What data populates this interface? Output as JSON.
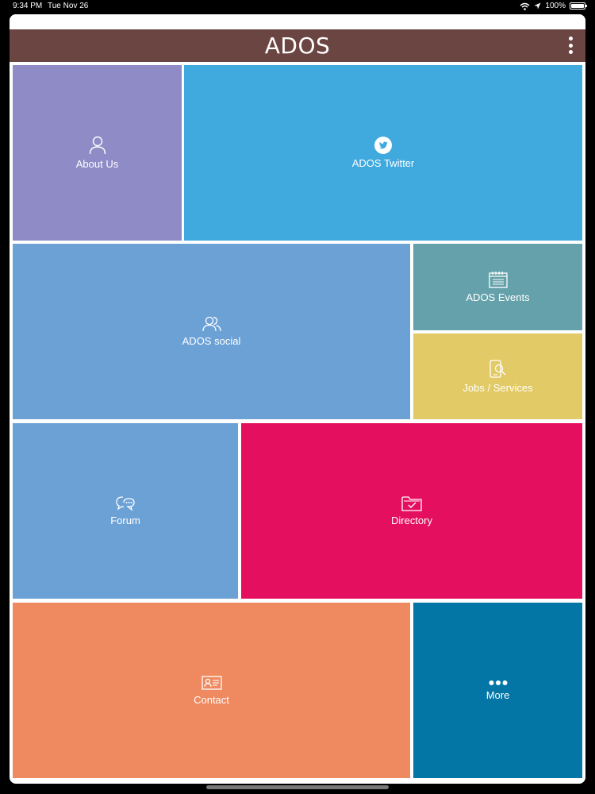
{
  "status_bar": {
    "time": "9:34 PM",
    "date": "Tue Nov 26",
    "battery": "100%"
  },
  "app": {
    "title": "ADOS"
  },
  "tiles": {
    "about": {
      "label": "About Us",
      "color": "#8f8bc6",
      "icon": "person-icon"
    },
    "twitter": {
      "label": "ADOS Twitter",
      "color": "#40a9de",
      "icon": "twitter-icon"
    },
    "social": {
      "label": "ADOS social",
      "color": "#6ca1d6",
      "icon": "people-icon"
    },
    "events": {
      "label": "ADOS Events",
      "color": "#64a1aa",
      "icon": "calendar-icon"
    },
    "jobs": {
      "label": "Jobs / Services",
      "color": "#e2ca66",
      "icon": "job-search-icon"
    },
    "forum": {
      "label": "Forum",
      "color": "#6ca1d6",
      "icon": "chat-bubbles-icon"
    },
    "directory": {
      "label": "Directory",
      "color": "#e50f5f",
      "icon": "folder-check-icon"
    },
    "contact": {
      "label": "Contact",
      "color": "#ef895f",
      "icon": "contact-card-icon"
    },
    "more": {
      "label": "More",
      "color": "#0376a5",
      "icon": "more-dots-icon"
    }
  },
  "colors": {
    "header": "#6b4541",
    "background": "#000000"
  }
}
